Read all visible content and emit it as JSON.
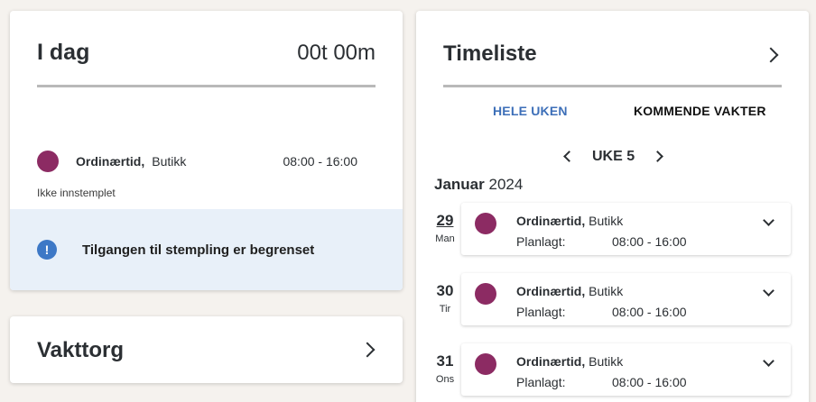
{
  "today": {
    "title": "I dag",
    "total": "00t 00m",
    "shift": {
      "type": "Ordinærtid,",
      "place": "Butikk",
      "time": "08:00 - 16:00"
    },
    "status": "Ikke innstemplet",
    "notice": "Tilgangen til stempling er begrenset",
    "colors": {
      "shift_dot": "#8c2b63",
      "notice_bg": "#e8f0f9",
      "notice_icon": "#3d78c6"
    }
  },
  "vakttorg": {
    "title": "Vakttorg"
  },
  "timeliste": {
    "title": "Timeliste",
    "tabs": [
      {
        "label": "HELE UKEN",
        "active": true
      },
      {
        "label": "KOMMENDE VAKTER",
        "active": false
      }
    ],
    "week_label": "UKE 5",
    "month": "Januar",
    "year": "2024",
    "days": [
      {
        "num": "29",
        "name": "Man",
        "shift_type": "Ordinærtid,",
        "place": "Butikk",
        "planned_label": "Planlagt:",
        "time": "08:00 - 16:00"
      },
      {
        "num": "30",
        "name": "Tir",
        "shift_type": "Ordinærtid,",
        "place": "Butikk",
        "planned_label": "Planlagt:",
        "time": "08:00 - 16:00"
      },
      {
        "num": "31",
        "name": "Ons",
        "shift_type": "Ordinærtid,",
        "place": "Butikk",
        "planned_label": "Planlagt:",
        "time": "08:00 - 16:00"
      }
    ]
  }
}
